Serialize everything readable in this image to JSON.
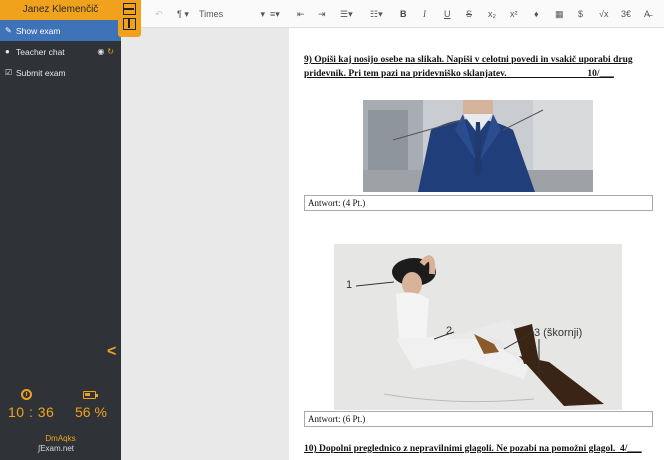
{
  "sidebar": {
    "user_name": "Janez Klemenčič",
    "items": [
      {
        "label": "Show exam"
      },
      {
        "label": "Teacher chat"
      },
      {
        "label": "Submit exam"
      }
    ],
    "timer": "10 : 36",
    "battery": "56 %",
    "user_code": "DmAqks",
    "brand": "Exam.net"
  },
  "toolbar": {
    "paragraph": "¶",
    "font": "Times",
    "buttons": [
      "B",
      "I",
      "U",
      "S",
      "x₂",
      "x²",
      "$"
    ]
  },
  "document": {
    "q9_line1": "9) Opiši kaj nosijo osebe na slikah. Napiši v celotni povedi in vsakič uporabi drug",
    "q9_line2": "pridevnik. Pri tem pazi na pridevniško sklanjatev.                                  10/___",
    "answer1": "Antwort: (4 Pt.)",
    "answer2": "Antwort: (6 Pt.)",
    "q10": "10) Dopolni preglednico z nepravilnimi glagoli. Ne pozabi na pomožni glagol.  4/___",
    "img2_annotations": [
      "1",
      "2",
      "3 (škornji)"
    ]
  },
  "colors": {
    "accent": "#f0a21c",
    "sidebar_bg": "#2f3338",
    "active": "#3e73b8"
  }
}
